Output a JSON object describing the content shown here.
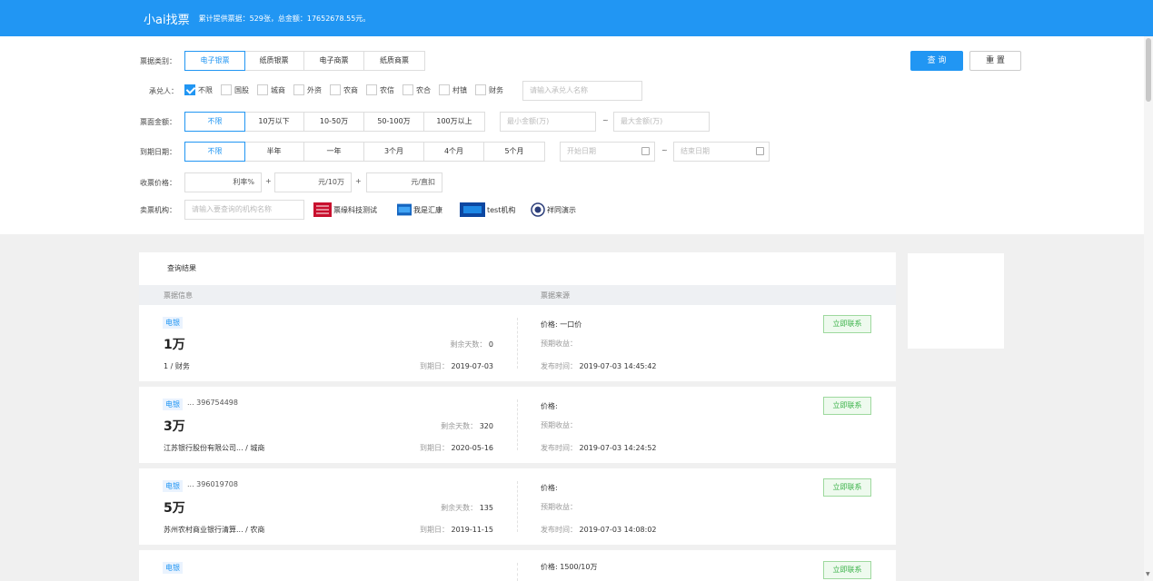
{
  "header": {
    "brand": "小ai找票",
    "stats": "累计提供票据：529张，总金额：17652678.55元。"
  },
  "filters": {
    "type": {
      "label": "票据类别：",
      "options": [
        "电子银票",
        "纸质银票",
        "电子商票",
        "纸质商票"
      ],
      "active": 0
    },
    "acceptor": {
      "label": "承兑人：",
      "options": [
        {
          "label": "不限",
          "checked": true
        },
        {
          "label": "国股",
          "checked": false
        },
        {
          "label": "城商",
          "checked": false
        },
        {
          "label": "外资",
          "checked": false
        },
        {
          "label": "农商",
          "checked": false
        },
        {
          "label": "农信",
          "checked": false
        },
        {
          "label": "农合",
          "checked": false
        },
        {
          "label": "村镇",
          "checked": false
        },
        {
          "label": "财务",
          "checked": false
        }
      ],
      "placeholder": "请输入承兑人名称"
    },
    "amount": {
      "label": "票面金额：",
      "options": [
        "不限",
        "10万以下",
        "10-50万",
        "50-100万",
        "100万以上"
      ],
      "active": 0,
      "min_placeholder": "最小金额(万)",
      "max_placeholder": "最大金额(万)",
      "sep": "~"
    },
    "due": {
      "label": "到期日期：",
      "options": [
        "不限",
        "半年",
        "一年",
        "3个月",
        "4个月",
        "5个月"
      ],
      "active": 0,
      "start_placeholder": "开始日期",
      "end_placeholder": "结束日期",
      "sep": "~"
    },
    "price": {
      "label": "收票价格：",
      "rate": "利率%",
      "per10w": "元/10万",
      "direct": "元/直扣",
      "plus": "+"
    },
    "org": {
      "label": "卖票机构：",
      "placeholder": "请输入要查询的机构名称",
      "items": [
        "票缘科技测试",
        "我是汇康",
        "test机构",
        "祥同演示"
      ]
    }
  },
  "actions": {
    "query": "查 询",
    "reset": "重 置"
  },
  "results": {
    "title": "查询结果",
    "col_info": "票据信息",
    "col_source": "票据来源",
    "items": [
      {
        "tag": "电银",
        "code": "",
        "amount": "1万",
        "remaining_label": "剩余天数：",
        "remaining": "0",
        "bank": "1 / 财务",
        "due_label": "到期日：",
        "due": "2019-07-03",
        "price": "价格: 一口价",
        "yield": "预期收益：",
        "pub_label": "发布时间：",
        "pub": "2019-07-03 14:45:42",
        "contact": "立即联系"
      },
      {
        "tag": "电银",
        "code": "... 396754498",
        "amount": "3万",
        "remaining_label": "剩余天数：",
        "remaining": "320",
        "bank": "江苏银行股份有限公司... / 城商",
        "due_label": "到期日：",
        "due": "2020-05-16",
        "price": "价格:",
        "yield": "预期收益：",
        "pub_label": "发布时间：",
        "pub": "2019-07-03 14:24:52",
        "contact": "立即联系"
      },
      {
        "tag": "电银",
        "code": "... 396019708",
        "amount": "5万",
        "remaining_label": "剩余天数：",
        "remaining": "135",
        "bank": "苏州农村商业银行清算... / 农商",
        "due_label": "到期日：",
        "due": "2019-11-15",
        "price": "价格:",
        "yield": "预期收益：",
        "pub_label": "发布时间：",
        "pub": "2019-07-03 14:08:02",
        "contact": "立即联系"
      },
      {
        "tag": "电银",
        "code": "",
        "amount": "",
        "remaining_label": "",
        "remaining": "",
        "bank": "",
        "due_label": "",
        "due": "",
        "price": "价格: 1500/10万",
        "yield": "",
        "pub_label": "",
        "pub": "",
        "contact": "立即联系"
      }
    ]
  },
  "colors": {
    "primary": "#2196f3",
    "contact_green": "#3cb34a"
  }
}
